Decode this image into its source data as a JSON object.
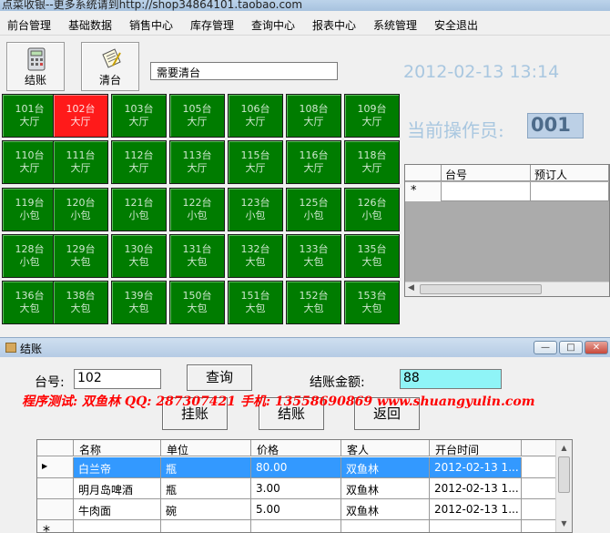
{
  "app": {
    "title": "点菜收银--更多系统请到http://shop34864101.taobao.com"
  },
  "menu": [
    "前台管理",
    "基础数据",
    "销售中心",
    "库存管理",
    "查询中心",
    "报表中心",
    "系统管理",
    "安全退出"
  ],
  "toolbar": {
    "checkout_label": "结账",
    "clear_label": "清台"
  },
  "notice": "需要清台",
  "clock": "2012-02-13 13:14",
  "operator": {
    "label": "当前操作员:",
    "value": "001"
  },
  "tables": [
    {
      "no": "101台",
      "area": "大厅",
      "status": "free"
    },
    {
      "no": "102台",
      "area": "大厅",
      "status": "occupied"
    },
    {
      "no": "103台",
      "area": "大厅",
      "status": "free"
    },
    {
      "no": "105台",
      "area": "大厅",
      "status": "free"
    },
    {
      "no": "106台",
      "area": "大厅",
      "status": "free"
    },
    {
      "no": "108台",
      "area": "大厅",
      "status": "free"
    },
    {
      "no": "109台",
      "area": "大厅",
      "status": "free"
    },
    {
      "no": "110台",
      "area": "大厅",
      "status": "free"
    },
    {
      "no": "111台",
      "area": "大厅",
      "status": "free"
    },
    {
      "no": "112台",
      "area": "大厅",
      "status": "free"
    },
    {
      "no": "113台",
      "area": "大厅",
      "status": "free"
    },
    {
      "no": "115台",
      "area": "大厅",
      "status": "free"
    },
    {
      "no": "116台",
      "area": "大厅",
      "status": "free"
    },
    {
      "no": "118台",
      "area": "大厅",
      "status": "free"
    },
    {
      "no": "119台",
      "area": "小包",
      "status": "free"
    },
    {
      "no": "120台",
      "area": "小包",
      "status": "free"
    },
    {
      "no": "121台",
      "area": "小包",
      "status": "free"
    },
    {
      "no": "122台",
      "area": "小包",
      "status": "free"
    },
    {
      "no": "123台",
      "area": "小包",
      "status": "free"
    },
    {
      "no": "125台",
      "area": "小包",
      "status": "free"
    },
    {
      "no": "126台",
      "area": "小包",
      "status": "free"
    },
    {
      "no": "128台",
      "area": "小包",
      "status": "free"
    },
    {
      "no": "129台",
      "area": "大包",
      "status": "free"
    },
    {
      "no": "130台",
      "area": "大包",
      "status": "free"
    },
    {
      "no": "131台",
      "area": "大包",
      "status": "free"
    },
    {
      "no": "132台",
      "area": "大包",
      "status": "free"
    },
    {
      "no": "133台",
      "area": "大包",
      "status": "free"
    },
    {
      "no": "135台",
      "area": "大包",
      "status": "free"
    },
    {
      "no": "136台",
      "area": "大包",
      "status": "free"
    },
    {
      "no": "138台",
      "area": "大包",
      "status": "free"
    },
    {
      "no": "139台",
      "area": "大包",
      "status": "free"
    },
    {
      "no": "150台",
      "area": "大包",
      "status": "free"
    },
    {
      "no": "151台",
      "area": "大包",
      "status": "free"
    },
    {
      "no": "152台",
      "area": "大包",
      "status": "free"
    },
    {
      "no": "153台",
      "area": "大包",
      "status": "free"
    }
  ],
  "reservations": {
    "headers": [
      "台号",
      "预订人"
    ],
    "new_row_marker": "*"
  },
  "dialog": {
    "title": "结账",
    "table_label": "台号:",
    "table_value": "102",
    "query_label": "查询",
    "amount_label": "结账金额:",
    "amount_value": "88",
    "banner": "程序测试: 双鱼林   QQ: 287307421   手机: 13558690869   www.shuangyulin.com",
    "hang_label": "挂账",
    "checkout_label": "结账",
    "back_label": "返回",
    "grid_headers": [
      "名称",
      "单位",
      "价格",
      "客人",
      "开台时间"
    ],
    "rows": [
      [
        "白兰帝",
        "瓶",
        "80.00",
        "双鱼林",
        "2012-02-13 1..."
      ],
      [
        "明月岛啤酒",
        "瓶",
        "3.00",
        "双鱼林",
        "2012-02-13 1..."
      ],
      [
        "牛肉面",
        "碗",
        "5.00",
        "双鱼林",
        "2012-02-13 1..."
      ]
    ],
    "window_buttons": [
      "—",
      "□",
      "✕"
    ]
  },
  "colors": {
    "table_free": "#007c00",
    "table_occupied": "#ff1a1a",
    "selected_row": "#3399ff",
    "banner": "#ff0000"
  }
}
